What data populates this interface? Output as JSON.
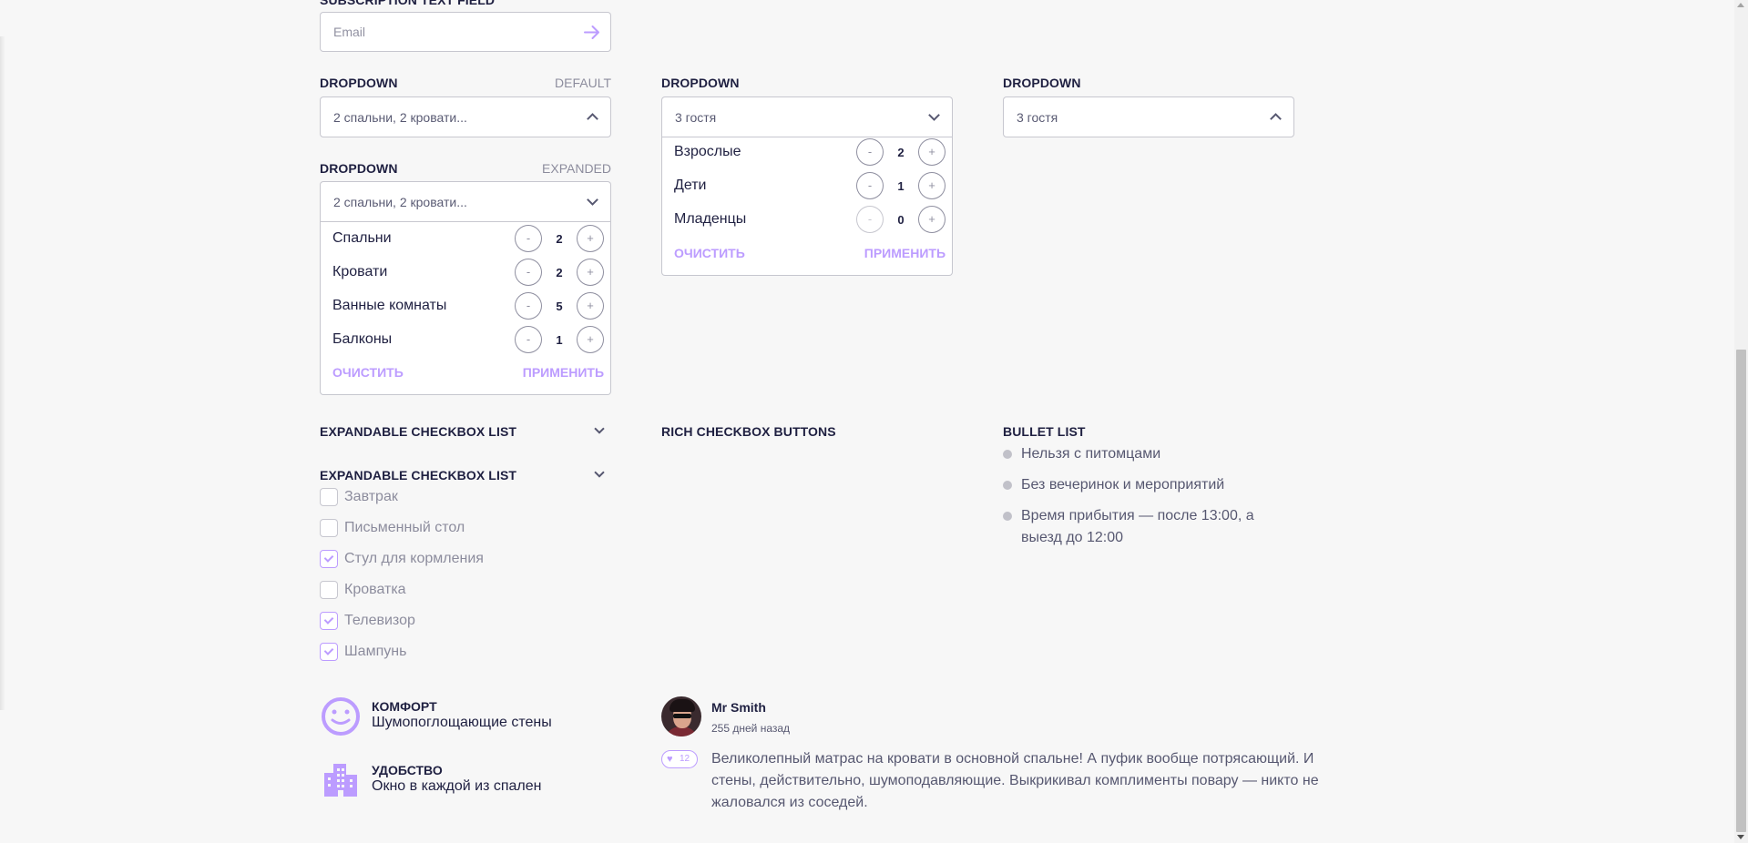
{
  "subscription": {
    "title": "SUBSCRIPTION TEXT FIELD",
    "placeholder": "Email"
  },
  "dropdown_default": {
    "title": "DROPDOWN",
    "state": "DEFAULT",
    "value": "2 спальни, 2 кровати..."
  },
  "dropdown_expanded": {
    "title": "DROPDOWN",
    "state": "EXPANDED",
    "value": "2 спальни, 2 кровати...",
    "rows": [
      {
        "label": "Спальни",
        "count": "2"
      },
      {
        "label": "Кровати",
        "count": "2"
      },
      {
        "label": "Ванные комнаты",
        "count": "5"
      },
      {
        "label": "Балконы",
        "count": "1"
      }
    ],
    "clear_label": "ОЧИСТИТЬ",
    "apply_label": "ПРИМЕНИТЬ"
  },
  "dropdown_guests": {
    "title": "DROPDOWN",
    "value": "3 гостя",
    "rows": [
      {
        "label": "Взрослые",
        "count": "2"
      },
      {
        "label": "Дети",
        "count": "1"
      },
      {
        "label": "Младенцы",
        "count": "0"
      }
    ],
    "clear_label": "ОЧИСТИТЬ",
    "apply_label": "ПРИМЕНИТЬ"
  },
  "dropdown_guests_collapsed": {
    "title": "DROPDOWN",
    "value": "3 гостя"
  },
  "stepper": {
    "minus": "-",
    "plus": "+"
  },
  "checkbox_list_collapsed": {
    "title": "EXPANDABLE CHECKBOX LIST"
  },
  "checkbox_list_expanded": {
    "title": "EXPANDABLE CHECKBOX LIST",
    "items": [
      {
        "label": "Завтрак",
        "checked": false
      },
      {
        "label": "Письменный стол",
        "checked": false
      },
      {
        "label": "Стул для кормления",
        "checked": true
      },
      {
        "label": "Кроватка",
        "checked": false
      },
      {
        "label": "Телевизор",
        "checked": true
      },
      {
        "label": "Шампунь",
        "checked": true
      }
    ]
  },
  "rich_checkbox": {
    "title": "RICH CHECKBOX BUTTONS"
  },
  "bullet_list": {
    "title": "BULLET LIST",
    "items": [
      "Нельзя с питомцами",
      "Без вечеринок и мероприятий",
      "Время прибытия — после 13:00, а",
      "выезд до 12:00"
    ]
  },
  "benefits": [
    {
      "icon": "smile-icon",
      "title": "КОМФОРТ",
      "text": "Шумопоглощающие стены"
    },
    {
      "icon": "building-icon",
      "title": "УДОБСТВО",
      "text": "Окно в каждой из спален"
    }
  ],
  "comment": {
    "author": "Mr Smith",
    "date": "255 дней назад",
    "likes": "12",
    "text_lines": [
      "Великолепный матрас на кровати в основной спальне! А пуфик вообще потрясающий. И",
      "стены, действительно, шумоподавляющие. Выкрикивал комплименты повару — никто не",
      "жаловался из соседей."
    ]
  },
  "colors": {
    "accent": "#bc9cff",
    "dark": "#1f2041",
    "background": "#f7f7f7"
  }
}
